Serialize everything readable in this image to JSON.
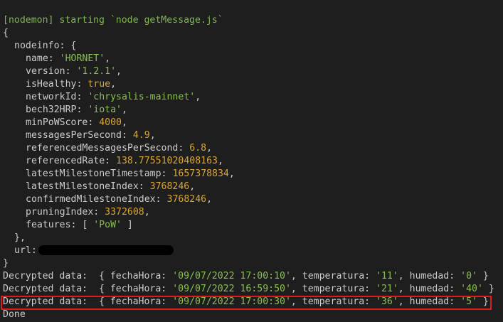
{
  "nodemon_line": "[nodemon] starting `node getMessage.js`",
  "open_brace": "{",
  "close_brace": "}",
  "nodeinfo": {
    "key": "nodeinfo: {",
    "close": "},",
    "fields": [
      {
        "name": "name: ",
        "value": "'HORNET'",
        "kind": "str",
        "tail": ","
      },
      {
        "name": "version: ",
        "value": "'1.2.1'",
        "kind": "str",
        "tail": ","
      },
      {
        "name": "isHealthy: ",
        "value": "true",
        "kind": "kw",
        "tail": ","
      },
      {
        "name": "networkId: ",
        "value": "'chrysalis-mainnet'",
        "kind": "str",
        "tail": ","
      },
      {
        "name": "bech32HRP: ",
        "value": "'iota'",
        "kind": "str",
        "tail": ","
      },
      {
        "name": "minPoWScore: ",
        "value": "4000",
        "kind": "num",
        "tail": ","
      },
      {
        "name": "messagesPerSecond: ",
        "value": "4.9",
        "kind": "num",
        "tail": ","
      },
      {
        "name": "referencedMessagesPerSecond: ",
        "value": "6.8",
        "kind": "num",
        "tail": ","
      },
      {
        "name": "referencedRate: ",
        "value": "138.77551020408163",
        "kind": "num",
        "tail": ","
      },
      {
        "name": "latestMilestoneTimestamp: ",
        "value": "1657378834",
        "kind": "num",
        "tail": ","
      },
      {
        "name": "latestMilestoneIndex: ",
        "value": "3768246",
        "kind": "num",
        "tail": ","
      },
      {
        "name": "confirmedMilestoneIndex: ",
        "value": "3768246",
        "kind": "num",
        "tail": ","
      },
      {
        "name": "pruningIndex: ",
        "value": "3372608",
        "kind": "num",
        "tail": ","
      }
    ],
    "features_key": "features: [ ",
    "features_value": "'PoW'",
    "features_close": " ]"
  },
  "url_key": "url:",
  "decrypted": [
    {
      "prefix": "Decrypted data:  { fechaHora: ",
      "fecha": "'09/07/2022 17:00:10'",
      "mid1": ", temperatura: ",
      "temp": "'11'",
      "mid2": ", humedad: ",
      "hum": "'0'",
      "end": " }"
    },
    {
      "prefix": "Decrypted data:  { fechaHora: ",
      "fecha": "'09/07/2022 16:59:50'",
      "mid1": ", temperatura: ",
      "temp": "'21'",
      "mid2": ", humedad: ",
      "hum": "'40'",
      "end": " }"
    },
    {
      "prefix": "Decrypted data:  { fechaHora: ",
      "fecha": "'09/07/2022 17:00:30'",
      "mid1": ", temperatura: ",
      "temp": "'36'",
      "mid2": ", humedad: ",
      "hum": "'5'",
      "end": " }"
    }
  ],
  "done_text": "Done",
  "colors": {
    "background": "#1e1e1e",
    "string": "#87c04f",
    "number": "#d7a53c",
    "highlight_border": "#e01b1b"
  }
}
